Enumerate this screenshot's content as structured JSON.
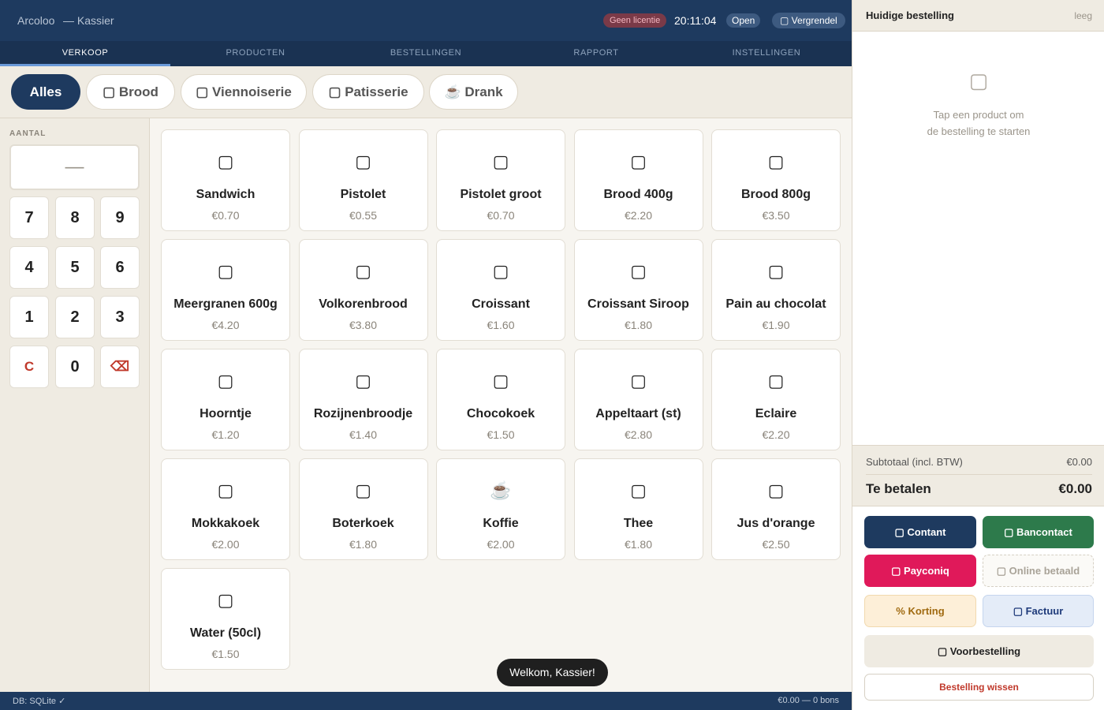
{
  "header": {
    "brand": "Arcoloo",
    "subtitle": "— Kassier",
    "license_badge": "Geen licentie",
    "clock": "20:11:04",
    "status_badge": "Open",
    "lock_label": "▢ Vergrendel"
  },
  "tabs": [
    "VERKOOP",
    "PRODUCTEN",
    "BESTELLINGEN",
    "RAPPORT",
    "INSTELLINGEN"
  ],
  "active_tab": "VERKOOP",
  "categories": [
    {
      "label": "Alles",
      "active": true
    },
    {
      "label": "▢ Brood",
      "active": false
    },
    {
      "label": "▢ Viennoiserie",
      "active": false
    },
    {
      "label": "▢ Patisserie",
      "active": false
    },
    {
      "label": "☕ Drank",
      "active": false
    }
  ],
  "numpad": {
    "label": "AANTAL",
    "display": "—",
    "keys": [
      "7",
      "8",
      "9",
      "4",
      "5",
      "6",
      "1",
      "2",
      "3",
      "C",
      "0",
      "⌫"
    ]
  },
  "products": [
    {
      "icon": "▢",
      "name": "Sandwich",
      "price": "€0.70"
    },
    {
      "icon": "▢",
      "name": "Pistolet",
      "price": "€0.55"
    },
    {
      "icon": "▢",
      "name": "Pistolet groot",
      "price": "€0.70"
    },
    {
      "icon": "▢",
      "name": "Brood 400g",
      "price": "€2.20"
    },
    {
      "icon": "▢",
      "name": "Brood 800g",
      "price": "€3.50"
    },
    {
      "icon": "▢",
      "name": "Meergranen 600g",
      "price": "€4.20"
    },
    {
      "icon": "▢",
      "name": "Volkorenbrood",
      "price": "€3.80"
    },
    {
      "icon": "▢",
      "name": "Croissant",
      "price": "€1.60"
    },
    {
      "icon": "▢",
      "name": "Croissant Siroop",
      "price": "€1.80"
    },
    {
      "icon": "▢",
      "name": "Pain au chocolat",
      "price": "€1.90"
    },
    {
      "icon": "▢",
      "name": "Hoorntje",
      "price": "€1.20"
    },
    {
      "icon": "▢",
      "name": "Rozijnenbroodje",
      "price": "€1.40"
    },
    {
      "icon": "▢",
      "name": "Chocokoek",
      "price": "€1.50"
    },
    {
      "icon": "▢",
      "name": "Appeltaart (st)",
      "price": "€2.80"
    },
    {
      "icon": "▢",
      "name": "Eclaire",
      "price": "€2.20"
    },
    {
      "icon": "▢",
      "name": "Mokkakoek",
      "price": "€2.00"
    },
    {
      "icon": "▢",
      "name": "Boterkoek",
      "price": "€1.80"
    },
    {
      "icon": "☕",
      "name": "Koffie",
      "price": "€2.00"
    },
    {
      "icon": "▢",
      "name": "Thee",
      "price": "€1.80"
    },
    {
      "icon": "▢",
      "name": "Jus d'orange",
      "price": "€2.50"
    },
    {
      "icon": "▢",
      "name": "Water (50cl)",
      "price": "€1.50"
    }
  ],
  "toast": "Welkom, Kassier!",
  "statusbar": {
    "left": "DB: SQLite ✓",
    "right": "€0.00 — 0 bons"
  },
  "order": {
    "title": "Huidige bestelling",
    "empty_tag": "leeg",
    "empty_icon": "▢",
    "empty_line1": "Tap een product om",
    "empty_line2": "de bestelling te starten",
    "subtotal_label": "Subtotaal (incl. BTW)",
    "subtotal_value": "€0.00",
    "total_label": "Te betalen",
    "total_value": "€0.00"
  },
  "payment": {
    "cash": "▢ Contant",
    "bancontact": "▢ Bancontact",
    "payconiq": "▢ Payconiq",
    "online": "▢ Online betaald",
    "korting": "% Korting",
    "factuur": "▢ Factuur",
    "voorbestelling": "▢ Voorbestelling",
    "clear": "Bestelling wissen"
  },
  "colors": {
    "primary": "#1e3a5f",
    "bancontact": "#2d7a4b",
    "payconiq": "#e0195a",
    "danger": "#c0392b"
  }
}
